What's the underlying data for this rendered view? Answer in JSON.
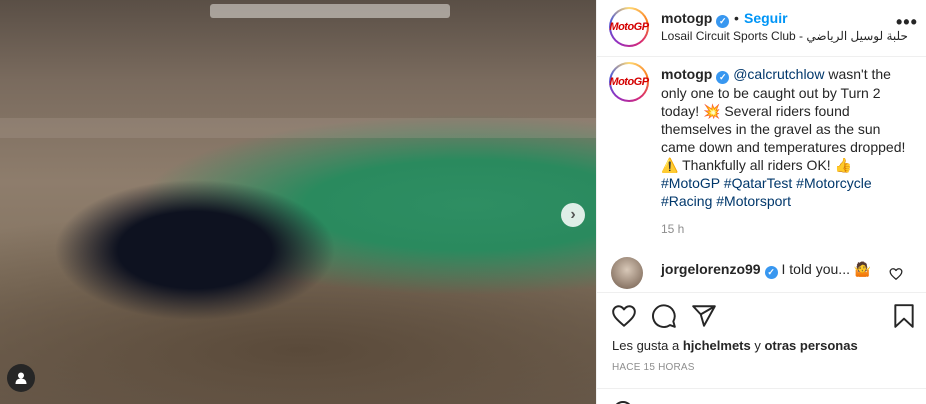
{
  "post": {
    "account": "motogp",
    "follow_label": "Seguir",
    "dot": "•",
    "location": "Losail Circuit Sports Club - حلبة لوسيل الرياضي",
    "avatar_text": "MotoGP",
    "more_label": "•••"
  },
  "caption": {
    "username": "motogp",
    "mention": "@calcrutchlow",
    "text_part1": " wasn't the only one to be caught out by Turn 2 today! 💥 Several riders found themselves in the gravel as the sun came down and temperatures dropped! ⚠️ Thankfully all riders OK! 👍 ",
    "hashtags": [
      "#MotoGP",
      "#QatarTest",
      "#Motorcycle",
      "#Racing",
      "#Motorsport"
    ],
    "time": "15 h"
  },
  "comments": [
    {
      "username": "jorgelorenzo99",
      "text": "I told you... 🤷"
    }
  ],
  "likes": {
    "prefix": "Les gusta a ",
    "user": "hjchelmets",
    "suffix": " y ",
    "others": "otras personas"
  },
  "timeago": "HACE 15 HORAS",
  "colors": {
    "accent": "#0095f6",
    "verified": "#3897f0",
    "text": "#262626",
    "muted": "#8e8e8e"
  },
  "icons": {
    "like": "heart-icon",
    "comment": "comment-icon",
    "share": "share-icon",
    "save": "bookmark-icon",
    "next": "chevron-right-icon",
    "tags": "user-tag-icon",
    "more": "more-options-icon"
  }
}
